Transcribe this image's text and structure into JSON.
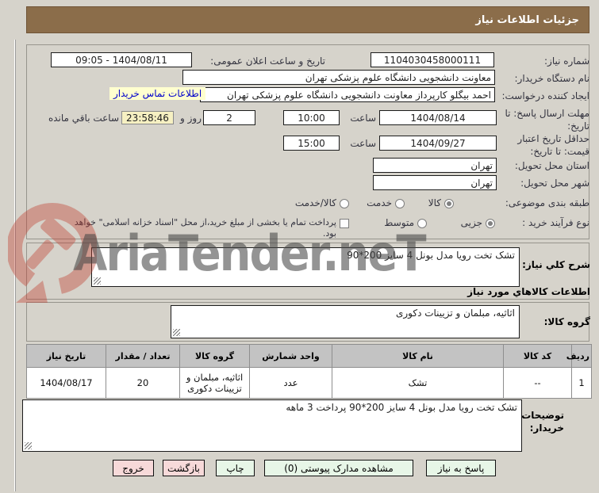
{
  "header": {
    "title": "جزئیات اطلاعات نیاز"
  },
  "form": {
    "need_number": {
      "label": "شماره نیاز:",
      "value": "1104030458000111"
    },
    "announce": {
      "label": "تاریخ و ساعت اعلان عمومی:",
      "value": "1404/08/11 - 09:05"
    },
    "buyer_org": {
      "label": "نام دستگاه خریدار:",
      "value": "معاونت دانشجویی دانشگاه علوم پزشکی تهران"
    },
    "creator": {
      "label": "ایجاد کننده درخواست:",
      "value": "احمد بیگلو کارپرداز معاونت دانشجویی دانشگاه علوم پزشکی تهران",
      "contact_link": "اطلاعات تماس خریدار"
    },
    "deadline": {
      "label": "مهلت ارسال پاسخ: تا تاریخ:",
      "date": "1404/08/14",
      "hour_label": "ساعت",
      "time": "10:00",
      "days": "2",
      "days_label": "روز و",
      "remaining": "23:58:46",
      "remaining_label": "ساعت باقي مانده"
    },
    "validity": {
      "label": "حداقل تاریخ اعتبار قیمت: تا تاریخ:",
      "date": "1404/09/27",
      "hour_label": "ساعت",
      "time": "15:00"
    },
    "province": {
      "label": "استان محل تحویل:",
      "value": "تهران"
    },
    "city": {
      "label": "شهر محل تحویل:",
      "value": "تهران"
    },
    "subject_class": {
      "label": "طبقه بندی موضوعی:",
      "options": [
        "کالا",
        "خدمت",
        "کالا/خدمت"
      ],
      "selected": "کالا"
    },
    "process": {
      "label": "نوع فرآیند خرید :",
      "options": [
        "جزیی",
        "متوسط"
      ],
      "selected": "جزیی",
      "checkbox_label": "پرداخت تمام یا بخشی از مبلغ خرید،از محل \"اسناد خزانه اسلامی\" خواهد بود."
    }
  },
  "need_desc": {
    "label": "شرح کلي نیاز:",
    "value": "تشک تخت رویا  مدل بونل 4 سایز 200*90"
  },
  "goods": {
    "heading": "اطلاعات كالاهاي مورد نياز",
    "group_label": "گروه کالا:",
    "group_value": "اثاثیه، مبلمان و تزیینات دکوری"
  },
  "table": {
    "headers": [
      "ردیف",
      "کد کالا",
      "نام کالا",
      "واحد شمارش",
      "گروه کالا",
      "تعداد / مقدار",
      "تاریخ نیاز"
    ],
    "rows": [
      [
        "1",
        "--",
        "تشک",
        "عدد",
        "اثاثیه، مبلمان و تزیینات دکوری",
        "20",
        "1404/08/17"
      ]
    ]
  },
  "notes": {
    "label": "توضیحات خریدار:",
    "value": "تشک تخت رویا  مدل بونل 4 سایز 200*90 پرداخت 3 ماهه"
  },
  "buttons": {
    "reply": "پاسخ به نیاز",
    "attachments": "مشاهده مدارک پیوستی (0)",
    "print": "چاپ",
    "back": "بازگشت",
    "exit": "خروج"
  },
  "watermark": {
    "text": "AriaTender.neT"
  },
  "colors": {
    "header_bg": "#8b6d4a",
    "link": "#0000cc",
    "remaining_bg": "#f6f0c2",
    "btn_green": "#e7f6e7",
    "btn_pink": "#f7d9d9",
    "watermark_red": "#c0392b"
  }
}
